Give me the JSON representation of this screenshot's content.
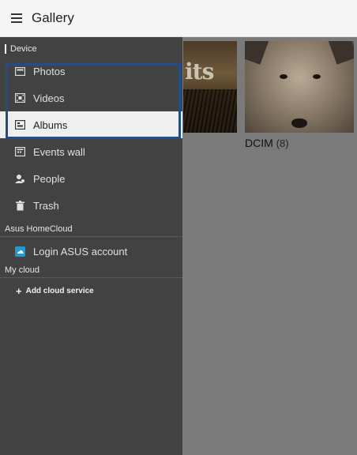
{
  "app": {
    "title": "Gallery"
  },
  "drawer": {
    "sections": {
      "device": "Device",
      "homecloud": "Asus HomeCloud",
      "mycloud": "My cloud"
    },
    "items": [
      {
        "label": "Photos",
        "icon": "photos-icon"
      },
      {
        "label": "Videos",
        "icon": "film-icon"
      },
      {
        "label": "Albums",
        "icon": "albums-icon",
        "selected": true
      },
      {
        "label": "Events wall",
        "icon": "calendar-icon"
      },
      {
        "label": "People",
        "icon": "person-icon"
      },
      {
        "label": "Trash",
        "icon": "trash-icon"
      }
    ],
    "login": {
      "label": "Login ASUS account",
      "icon": "cloud-icon"
    },
    "add_cloud": {
      "label": "Add cloud service",
      "icon": "plus-icon"
    }
  },
  "albums": [
    {
      "name": "DCIM",
      "count": "(8)"
    }
  ],
  "colors": {
    "highlight": "#1f4e89",
    "drawer_bg": "#424242",
    "login_icon": "#1a9ad6"
  }
}
